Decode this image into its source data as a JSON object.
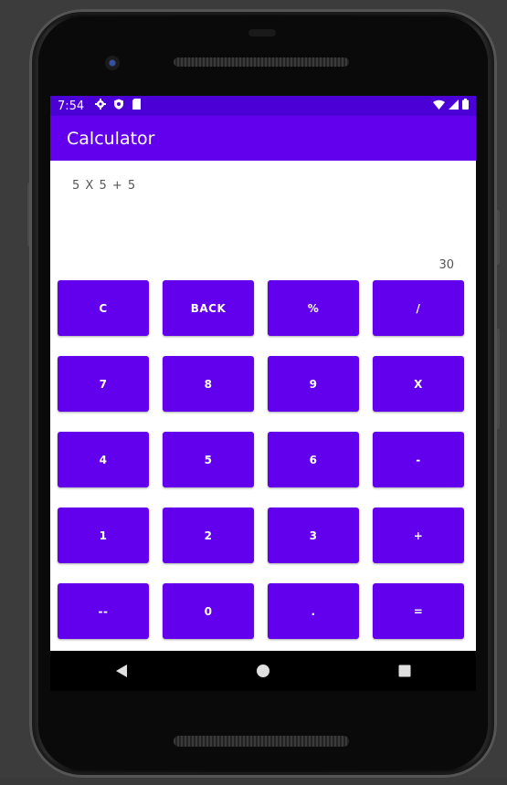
{
  "status_bar": {
    "time": "7:54",
    "left_icons": [
      "gear-icon",
      "shield-icon",
      "sd-card-icon"
    ],
    "right_icons": [
      "wifi-icon",
      "signal-icon",
      "battery-icon"
    ]
  },
  "app_bar": {
    "title": "Calculator"
  },
  "display": {
    "expression": "5 X 5 + 5",
    "result": "30"
  },
  "keypad": {
    "keys": [
      "C",
      "BACK",
      "%",
      "/",
      "7",
      "8",
      "9",
      "X",
      "4",
      "5",
      "6",
      "-",
      "1",
      "2",
      "3",
      "+",
      "--",
      "0",
      ".",
      "="
    ]
  },
  "nav_bar": {
    "items": [
      "back-icon",
      "home-icon",
      "recents-icon"
    ]
  },
  "colors": {
    "primary": "#6200ee",
    "primary_dark": "#4b00d6",
    "text_secondary": "#555555"
  }
}
